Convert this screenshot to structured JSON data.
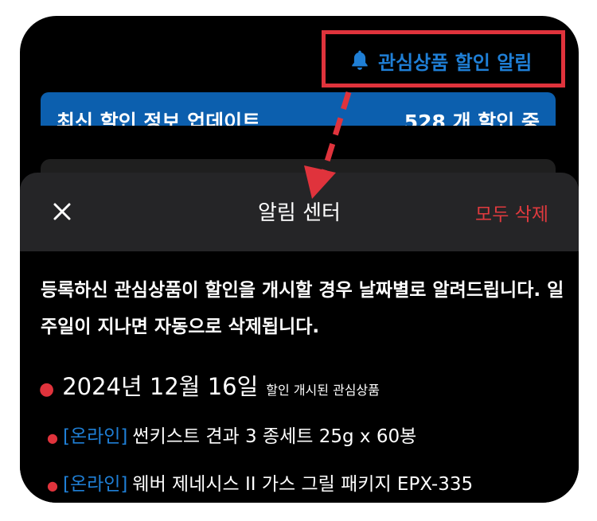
{
  "header": {
    "alert_link_label": "관심상품 할인 알림",
    "alert_icon": "bell-icon"
  },
  "banner": {
    "title": "최신 할인 정보 업데이트",
    "count": "528 개 할인 중"
  },
  "sheet": {
    "title": "알림 센터",
    "close_icon": "close-icon",
    "clear_all_label": "모두 삭제",
    "description": "등록하신 관심상품이 할인을 개시할 경우 날짜별로 알려드립니다. 일주일이 지나면 자동으로 삭제됩니다.",
    "groups": [
      {
        "date": "2024년 12월 16일",
        "subtitle": "할인 개시된 관심상품",
        "items": [
          {
            "tag": "[온라인]",
            "name": "썬키스트 견과  3 종세트 25g x 60봉"
          },
          {
            "tag": "[온라인]",
            "name": "웨버 제네시스 II 가스 그릴 패키지 EPX-335"
          }
        ]
      }
    ]
  },
  "colors": {
    "accent_blue": "#1f7fd6",
    "highlight_red": "#e0333c",
    "banner_blue": "#0c5fae",
    "sheet_header": "#252527"
  }
}
